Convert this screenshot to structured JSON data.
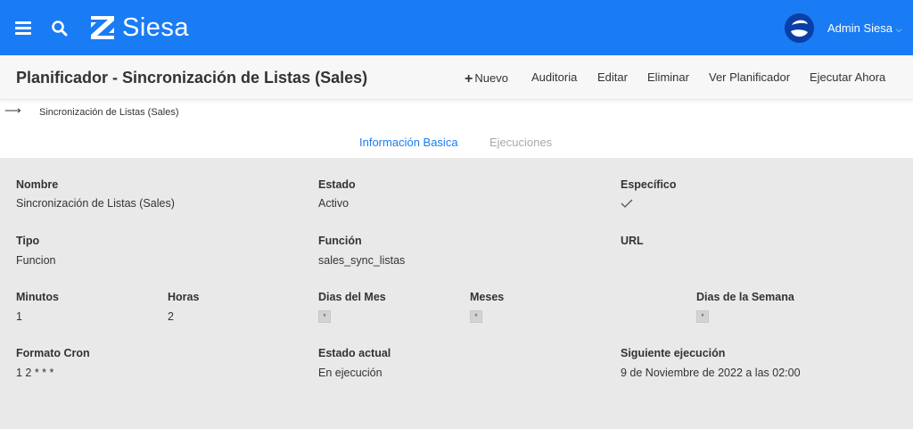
{
  "app": {
    "logo_text": "Siesa",
    "user_name": "Admin Siesa",
    "colors": {
      "primary": "#1a7cf4",
      "avatar": "#0a3fa8"
    }
  },
  "header": {
    "title": "Planificador - Sincronización de Listas (Sales)",
    "actions": {
      "new": "Nuevo",
      "audit": "Auditoria",
      "edit": "Editar",
      "delete": "Eliminar",
      "view_scheduler": "Ver Planificador",
      "run_now": "Ejecutar Ahora"
    }
  },
  "breadcrumb": {
    "arrow": "⟶",
    "label": "Sincronización de Listas (Sales)"
  },
  "tabs": {
    "basic": "Información Basica",
    "executions": "Ejecuciones"
  },
  "fields": {
    "name": {
      "label": "Nombre",
      "value": "Sincronización de Listas (Sales)"
    },
    "state": {
      "label": "Estado",
      "value": "Activo"
    },
    "specific": {
      "label": "Específico",
      "value_icon": "check-icon"
    },
    "type": {
      "label": "Tipo",
      "value": "Funcion"
    },
    "function": {
      "label": "Función",
      "value": "sales_sync_listas"
    },
    "url": {
      "label": "URL",
      "value": ""
    },
    "minutes": {
      "label": "Minutos",
      "value": "1"
    },
    "hours": {
      "label": "Horas",
      "value": "2"
    },
    "days_month": {
      "label": "Dias del Mes",
      "value": "*"
    },
    "months": {
      "label": "Meses",
      "value": "*"
    },
    "days_week": {
      "label": "Dias de la Semana",
      "value": "*"
    },
    "cron": {
      "label": "Formato Cron",
      "value": "1 2 * * *"
    },
    "current_state": {
      "label": "Estado actual",
      "value": "En ejecución"
    },
    "next_run": {
      "label": "Siguiente ejecución",
      "value": "9 de Noviembre de 2022 a las 02:00"
    }
  }
}
